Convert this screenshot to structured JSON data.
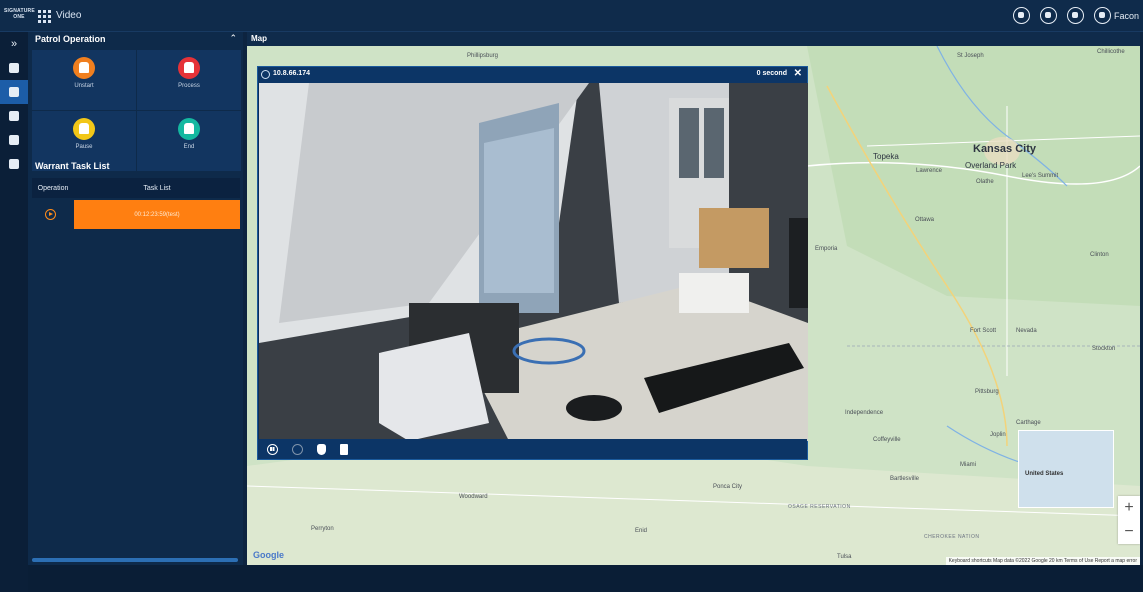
{
  "topbar": {
    "brand": "SIGNATURE ONE",
    "app_title": "Video",
    "user_name": "Facon",
    "icons": [
      "chat-icon",
      "bell-icon",
      "police-icon",
      "user-icon"
    ]
  },
  "rail": {
    "items": [
      "expand-icon",
      "vehicle-icon",
      "officer-icon",
      "patrol-icon",
      "group-icon",
      "document-icon"
    ],
    "active_index": 1
  },
  "patrol": {
    "title": "Patrol Operation",
    "operations": [
      {
        "label": "Unstart",
        "color": "#f07f1f"
      },
      {
        "label": "Process",
        "color": "#e53238"
      },
      {
        "label": "Pause",
        "color": "#f2c718"
      },
      {
        "label": "End",
        "color": "#14b8a0"
      }
    ]
  },
  "warrant": {
    "title": "Warrant Task List",
    "columns": [
      "Operation",
      "Task List"
    ],
    "rows": [
      {
        "task": "00:12:23:59(test)"
      }
    ]
  },
  "map": {
    "title": "Map",
    "labels": {
      "kansas_city": "Kansas City",
      "overland_park": "Overland Park",
      "topeka": "Topeka",
      "st_joseph": "St Joseph",
      "lawrence": "Lawrence",
      "olathe": "Olathe",
      "lees_summit": "Lee's Summit",
      "emporia": "Emporia",
      "ottawa": "Ottawa",
      "fort_scott": "Fort Scott",
      "nevada": "Nevada",
      "pittsburg": "Pittsburg",
      "independence": "Independence",
      "coffeyville": "Coffeyville",
      "bartlesville": "Bartlesville",
      "ponca_city": "Ponca City",
      "enid": "Enid",
      "woodward": "Woodward",
      "perryton": "Perryton",
      "phillipsburg": "Phillipsburg",
      "chillicothe": "Chillicothe",
      "clinton": "Clinton",
      "stockton": "Stockton",
      "joplin": "Joplin",
      "miami": "Miami",
      "carthage": "Carthage",
      "united_states": "United States",
      "osage": "OSAGE RESERVATION",
      "cherokee": "CHEROKEE NATION",
      "tulsa": "Tulsa"
    },
    "attribution": "Keyboard shortcuts   Map data ©2022 Google   20 km   Terms of Use   Report a map error",
    "google": "Google"
  },
  "video": {
    "ip": "10.8.66.174",
    "timer": "0 second",
    "controls": [
      "pause-icon",
      "mic-icon",
      "hand-icon",
      "document-icon"
    ]
  },
  "colors": {
    "accent": "#1c5da8",
    "task_highlight": "#ff7f11",
    "panel_bg": "#0e2a4a"
  }
}
